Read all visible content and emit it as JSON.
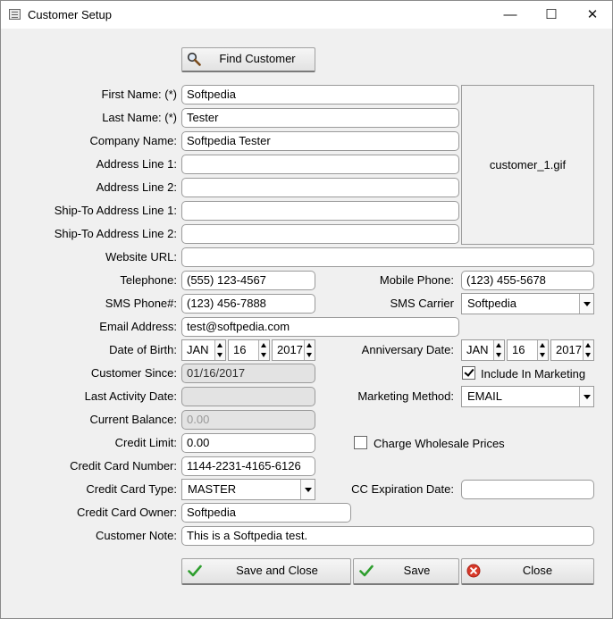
{
  "window": {
    "title": "Customer Setup",
    "minimize": "—",
    "maximize": "☐",
    "close": "✕"
  },
  "find_customer": {
    "label": "Find Customer",
    "icon": "magnifier-icon"
  },
  "image_box": {
    "label": "customer_1.gif"
  },
  "fields": {
    "first_name": {
      "label": "First Name: (*)",
      "value": "Softpedia"
    },
    "last_name": {
      "label": "Last Name: (*)",
      "value": "Tester"
    },
    "company_name": {
      "label": "Company Name:",
      "value": "Softpedia Tester"
    },
    "address_1": {
      "label": "Address Line 1:",
      "value": ""
    },
    "address_2": {
      "label": "Address Line 2:",
      "value": ""
    },
    "ship_1": {
      "label": "Ship-To Address Line 1:",
      "value": ""
    },
    "ship_2": {
      "label": "Ship-To Address Line 2:",
      "value": ""
    },
    "website": {
      "label": "Website URL:",
      "value": ""
    },
    "telephone": {
      "label": "Telephone:",
      "value": "(555) 123-4567"
    },
    "mobile_phone": {
      "label": "Mobile Phone:",
      "value": "(123) 455-5678"
    },
    "sms_phone": {
      "label": "SMS Phone#:",
      "value": "(123) 456-7888"
    },
    "sms_carrier": {
      "label": "SMS Carrier",
      "value": "Softpedia"
    },
    "email": {
      "label": "Email Address:",
      "value": "test@softpedia.com"
    },
    "dob": {
      "label": "Date of Birth:",
      "month": "JAN",
      "day": "16",
      "year": "2017"
    },
    "anniversary": {
      "label": "Anniversary Date:",
      "month": "JAN",
      "day": "16",
      "year": "2017"
    },
    "customer_since": {
      "label": "Customer Since:",
      "value": "01/16/2017"
    },
    "include_marketing": {
      "label": "Include In Marketing",
      "checked": true
    },
    "last_activity": {
      "label": "Last Activity Date:",
      "value": ""
    },
    "marketing_method": {
      "label": "Marketing Method:",
      "value": "EMAIL"
    },
    "current_balance": {
      "label": "Current Balance:",
      "value": "0.00"
    },
    "credit_limit": {
      "label": "Credit Limit:",
      "value": "0.00"
    },
    "charge_wholesale": {
      "label": "Charge Wholesale Prices",
      "checked": false
    },
    "cc_number": {
      "label": "Credit Card Number:",
      "value": "1144-2231-4165-6126"
    },
    "cc_type": {
      "label": "Credit Card Type:",
      "value": "MASTER"
    },
    "cc_expiration": {
      "label": "CC Expiration Date:",
      "value": ""
    },
    "cc_owner": {
      "label": "Credit Card Owner:",
      "value": "Softpedia"
    },
    "note": {
      "label": "Customer Note:",
      "value": "This is a Softpedia test."
    }
  },
  "buttons": {
    "save_close": {
      "label": "Save and Close",
      "icon": "checkmark-icon"
    },
    "save": {
      "label": "Save",
      "icon": "checkmark-icon"
    },
    "close": {
      "label": "Close",
      "icon": "close-circle-icon"
    }
  },
  "colors": {
    "check_green": "#2e9e2e",
    "close_red": "#d83a2a"
  }
}
